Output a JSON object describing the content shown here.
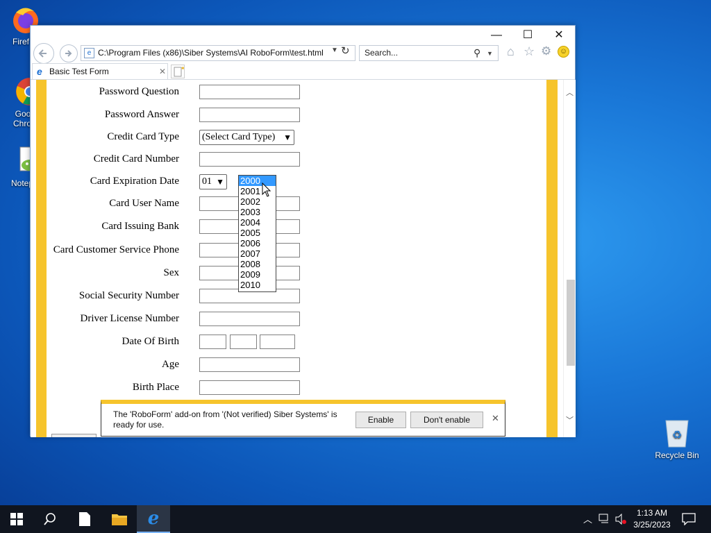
{
  "desktop": {
    "icons": {
      "firefox": "Firef",
      "chrome_1": "Goo",
      "chrome_2": "Chro",
      "notepad": "Notep",
      "recycle": "Recycle Bin"
    }
  },
  "browser": {
    "address": "C:\\Program Files (x86)\\Siber Systems\\AI RoboForm\\test.html",
    "search_placeholder": "Search...",
    "tab_title": "Basic Test Form"
  },
  "form": {
    "labels": {
      "password_question": "Password Question",
      "password_answer": "Password Answer",
      "credit_card_type": "Credit Card Type",
      "credit_card_number": "Credit Card Number",
      "card_expiration_date": "Card Expiration Date",
      "card_user_name": "Card User Name",
      "card_issuing_bank": "Card Issuing Bank",
      "card_customer_service_phone": "Card Customer Service Phone",
      "sex": "Sex",
      "ssn": "Social Security Number",
      "driver_license": "Driver License Number",
      "date_of_birth": "Date Of Birth",
      "age": "Age",
      "birth_place": "Birth Place"
    },
    "card_type_selected": "(Select Card Type)",
    "exp_month_selected": "01",
    "year_options": [
      "2000",
      "2001",
      "2002",
      "2003",
      "2004",
      "2005",
      "2006",
      "2007",
      "2008",
      "2009",
      "2010"
    ]
  },
  "notification": {
    "message": "The 'RoboForm' add-on from '(Not verified) Siber Systems' is ready for use.",
    "enable": "Enable",
    "dont_enable": "Don't enable"
  },
  "taskbar": {
    "time": "1:13 AM",
    "date": "3/25/2023"
  }
}
